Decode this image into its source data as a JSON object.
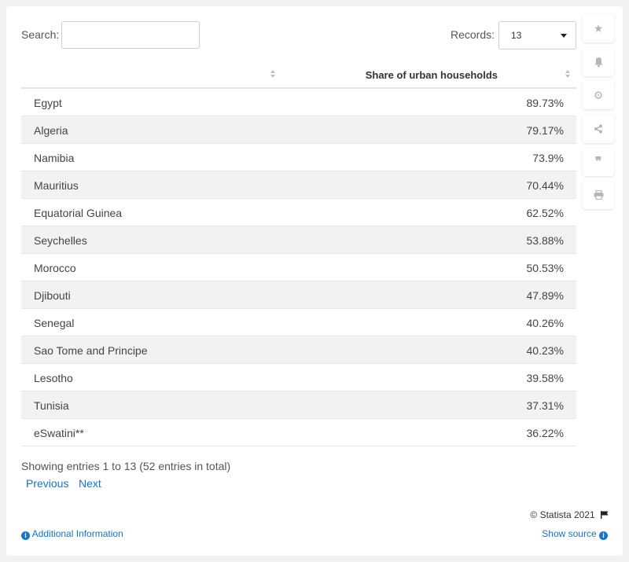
{
  "search": {
    "label": "Search:",
    "value": ""
  },
  "records": {
    "label": "Records:",
    "value": "13"
  },
  "table": {
    "columns": [
      "",
      "Share of urban households"
    ],
    "rows": [
      {
        "country": "Egypt",
        "value": "89.73%"
      },
      {
        "country": "Algeria",
        "value": "79.17%"
      },
      {
        "country": "Namibia",
        "value": "73.9%"
      },
      {
        "country": "Mauritius",
        "value": "70.44%"
      },
      {
        "country": "Equatorial Guinea",
        "value": "62.52%"
      },
      {
        "country": "Seychelles",
        "value": "53.88%"
      },
      {
        "country": "Morocco",
        "value": "50.53%"
      },
      {
        "country": "Djibouti",
        "value": "47.89%"
      },
      {
        "country": "Senegal",
        "value": "40.26%"
      },
      {
        "country": "Sao Tome and Principe",
        "value": "40.23%"
      },
      {
        "country": "Lesotho",
        "value": "39.58%"
      },
      {
        "country": "Tunisia",
        "value": "37.31%"
      },
      {
        "country": "eSwatini**",
        "value": "36.22%"
      }
    ]
  },
  "footer": {
    "info": "Showing entries 1 to 13 (52 entries in total)",
    "previous": "Previous",
    "next": "Next",
    "copyright": "© Statista 2021",
    "additional_info": "Additional Information",
    "show_source": "Show source"
  },
  "toolbar": {
    "items": [
      {
        "icon": "star-icon",
        "glyph": "★"
      },
      {
        "icon": "bell-icon",
        "glyph": "🔔"
      },
      {
        "icon": "gear-icon",
        "glyph": "⚙"
      },
      {
        "icon": "share-icon",
        "glyph": "<"
      },
      {
        "icon": "quote-icon",
        "glyph": "❞"
      },
      {
        "icon": "print-icon",
        "glyph": "⎙"
      }
    ]
  },
  "colors": {
    "link": "#1a73c4",
    "row_alt": "#f2f2f2",
    "page_bg": "#f2f2f2"
  }
}
